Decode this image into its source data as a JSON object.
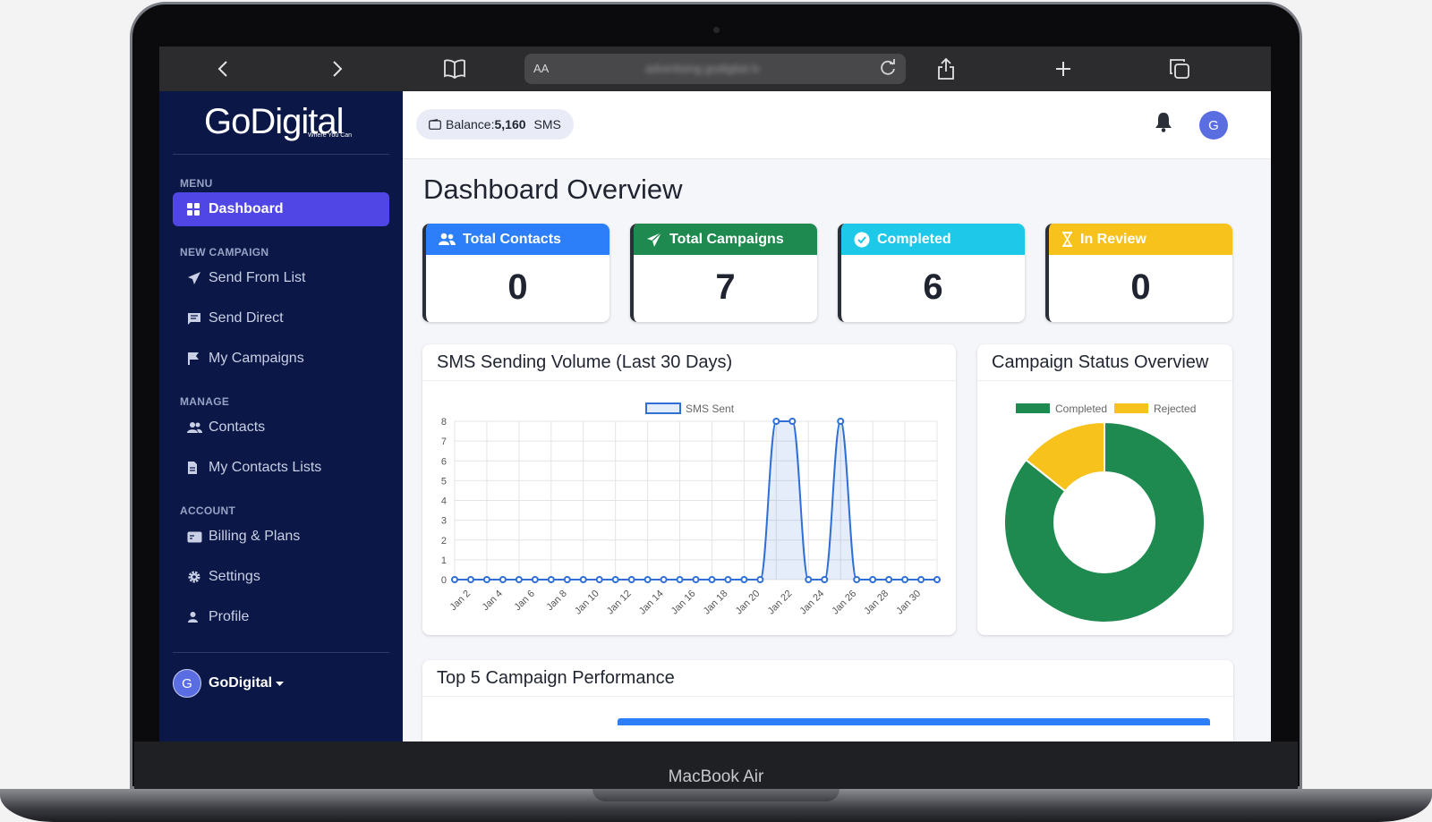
{
  "device": {
    "label": "MacBook Air"
  },
  "browser": {
    "aa_label": "AA",
    "url": "advertising.godigital.lv"
  },
  "brand": {
    "name": "GoDigital",
    "tagline": "Where You Can"
  },
  "sidebar": {
    "sections": [
      {
        "title": "MENU",
        "items": [
          {
            "label": "Dashboard",
            "icon": "grid-icon",
            "active": true
          }
        ]
      },
      {
        "title": "NEW CAMPAIGN",
        "items": [
          {
            "label": "Send From List",
            "icon": "paper-plane-icon"
          },
          {
            "label": "Send Direct",
            "icon": "message-icon"
          },
          {
            "label": "My Campaigns",
            "icon": "flag-icon"
          }
        ]
      },
      {
        "title": "MANAGE",
        "items": [
          {
            "label": "Contacts",
            "icon": "users-icon"
          },
          {
            "label": "My Contacts Lists",
            "icon": "file-icon"
          }
        ]
      },
      {
        "title": "ACCOUNT",
        "items": [
          {
            "label": "Billing & Plans",
            "icon": "billing-icon"
          },
          {
            "label": "Settings",
            "icon": "gear-icon"
          },
          {
            "label": "Profile",
            "icon": "user-icon"
          }
        ]
      }
    ],
    "user": {
      "initial": "G",
      "name": "GoDigital"
    }
  },
  "topbar": {
    "balance_label": "Balance:",
    "balance_value": "5,160",
    "balance_unit": "SMS",
    "avatar_initial": "G"
  },
  "page": {
    "title": "Dashboard Overview"
  },
  "stats": [
    {
      "label": "Total Contacts",
      "value": "0",
      "color": "#2d7ff9",
      "icon": "users-icon"
    },
    {
      "label": "Total Campaigns",
      "value": "7",
      "color": "#1e8a4f",
      "icon": "paper-plane-icon"
    },
    {
      "label": "Completed",
      "value": "6",
      "color": "#1ec8e8",
      "icon": "check-circle-icon"
    },
    {
      "label": "In Review",
      "value": "0",
      "color": "#f7c21c",
      "icon": "hourglass-icon"
    }
  ],
  "panels": {
    "volume_title": "SMS Sending Volume (Last 30 Days)",
    "status_title": "Campaign Status Overview",
    "top_title": "Top 5 Campaign Performance"
  },
  "chart_data": [
    {
      "type": "line",
      "series": [
        {
          "name": "SMS Sent",
          "color": "#2f6fd6",
          "values": [
            0,
            0,
            0,
            0,
            0,
            0,
            0,
            0,
            0,
            0,
            0,
            0,
            0,
            0,
            0,
            0,
            0,
            0,
            0,
            0,
            8,
            8,
            0,
            0,
            8,
            0,
            0,
            0,
            0,
            0,
            0
          ]
        }
      ],
      "x": [
        "Jan 1",
        "Jan 2",
        "Jan 3",
        "Jan 4",
        "Jan 5",
        "Jan 6",
        "Jan 7",
        "Jan 8",
        "Jan 9",
        "Jan 10",
        "Jan 11",
        "Jan 12",
        "Jan 13",
        "Jan 14",
        "Jan 15",
        "Jan 16",
        "Jan 17",
        "Jan 18",
        "Jan 19",
        "Jan 20",
        "Jan 21",
        "Jan 22",
        "Jan 23",
        "Jan 24",
        "Jan 25",
        "Jan 26",
        "Jan 27",
        "Jan 28",
        "Jan 29",
        "Jan 30",
        "Jan 31"
      ],
      "x_tick_labels": [
        "Jan 2",
        "Jan 4",
        "Jan 6",
        "Jan 8",
        "Jan 10",
        "Jan 12",
        "Jan 14",
        "Jan 16",
        "Jan 18",
        "Jan 20",
        "Jan 22",
        "Jan 24",
        "Jan 26",
        "Jan 28",
        "Jan 30"
      ],
      "y_ticks": [
        "0",
        "1",
        "2",
        "3",
        "4",
        "5",
        "6",
        "7",
        "8"
      ],
      "ylim": [
        0,
        8
      ],
      "grid": true,
      "legend": "top"
    },
    {
      "type": "pie",
      "categories": [
        "Completed",
        "Rejected"
      ],
      "values": [
        6,
        1
      ],
      "colors": [
        "#1e8a4f",
        "#f7c21c"
      ],
      "legend": "top"
    }
  ]
}
